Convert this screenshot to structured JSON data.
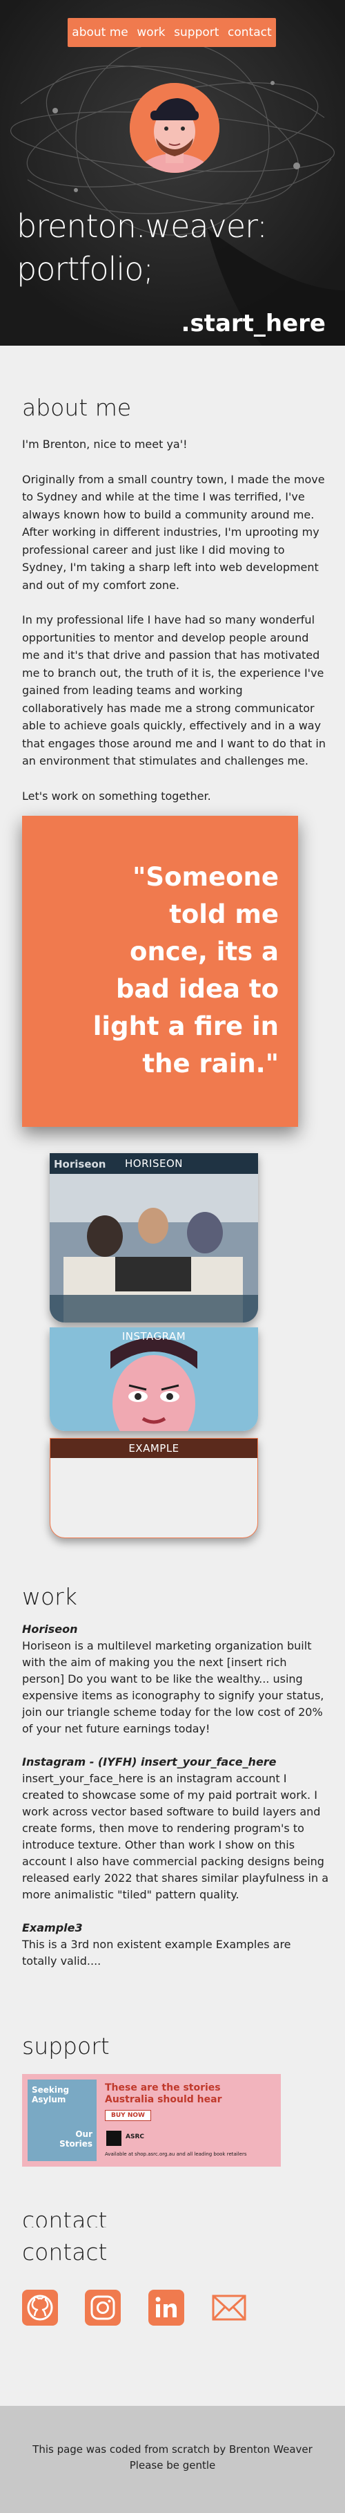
{
  "nav": {
    "about": "about me",
    "work": "work",
    "support": "support",
    "contact": "contact"
  },
  "hero": {
    "title_line1": "brenton.weaver:",
    "title_line2": "portfolio;",
    "start": ".start_here"
  },
  "about": {
    "title": "about me",
    "greeting": "I'm Brenton, nice to meet ya'!",
    "para1": "Originally from a small country town, I made the move to Sydney and while at the time I was terrified, I've always known how to build a community around me. After working in different industries, I'm uprooting my professional career and just like I did moving to Sydney, I'm taking a sharp left into web development and out of my comfort zone.",
    "para2": "In my professional life I have had so many wonderful opportunities to mentor and develop people around me and it's that drive and passion that has motivated me to branch out, the truth of it is, the experience I've gained from leading teams and working collaboratively has made me a strong communicator able to achieve goals quickly, effectively and in a way that engages those around me and I want to do that in an environment that stimulates and challenges me.",
    "para3": "Let's work on something together."
  },
  "quote": {
    "line1": "\"Someone",
    "line2": "told me",
    "line3": "once, its a",
    "line4": "bad idea to",
    "line5": "light a fire in",
    "line6": "the rain.\""
  },
  "cards": {
    "horiseon": {
      "label": "HORISEON",
      "logo": "Horiseon"
    },
    "instagram": {
      "label": "INSTAGRAM"
    },
    "example": {
      "label": "EXAMPLE"
    }
  },
  "work": {
    "title": "work",
    "items": [
      {
        "title": "Horiseon",
        "body": "Horiseon is a multilevel marketing organization built with the aim of making you the next [insert rich person] Do you want to be like the wealthy... using expensive items as iconography to signify your status, join our triangle scheme today for the low cost of 20% of your net future earnings today!"
      },
      {
        "title": "Instagram - (IYFH) insert_your_face_here",
        "body": "insert_your_face_here is an instagram account I created to showcase some of my paid portrait work. I work across vector based software to build layers and create forms, then move to rendering program's to introduce texture. Other than work I show on this account I also have commercial packing designs being released early 2022 that shares similar playfulness in a more animalistic \"tiled\" pattern quality."
      },
      {
        "title": "Example3",
        "body": "This is a 3rd non existent example Examples are totally valid...."
      }
    ]
  },
  "support": {
    "title": "support",
    "ad": {
      "book_title": "Seeking Asylum",
      "book_sub1": "Our",
      "book_sub2": "Stories",
      "headline": "These are the stories Australia should hear",
      "button": "BUY NOW",
      "publisher": "ASRC",
      "availability": "Available at shop.asrc.org.au and all leading book retailers"
    }
  },
  "contact": {
    "ghost_title": "contact",
    "title": "contact",
    "icons": [
      "github-icon",
      "instagram-icon",
      "linkedin-icon",
      "mail-icon"
    ]
  },
  "footer": {
    "line1": "This page was coded from scratch by Brenton Weaver",
    "line2": "Please be gentle"
  },
  "colors": {
    "accent": "#f07a4e",
    "hero_bg": "#1e1e1e",
    "page_bg": "#efefef",
    "footer_bg": "#c8c8c8"
  }
}
